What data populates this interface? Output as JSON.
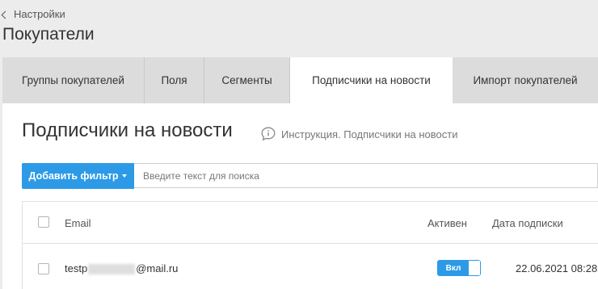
{
  "header": {
    "back_label": "Настройки",
    "title": "Покупатели"
  },
  "tabs": [
    {
      "label": "Группы покупателей",
      "active": false
    },
    {
      "label": "Поля",
      "active": false
    },
    {
      "label": "Сегменты",
      "active": false
    },
    {
      "label": "Подписчики на новости",
      "active": true
    },
    {
      "label": "Импорт покупателей",
      "active": false
    }
  ],
  "main": {
    "title": "Подписчики на новости",
    "help_link": "Инструкция. Подписчики на новости",
    "add_filter_label": "Добавить фильтр",
    "search_placeholder": "Введите текст для поиска"
  },
  "table": {
    "columns": {
      "email": "Email",
      "active": "Активен",
      "date": "Дата подписки"
    },
    "rows": [
      {
        "email_prefix": "testp",
        "email_suffix": "@mail.ru",
        "active_label": "Вкл",
        "active": true,
        "date": "22.06.2021 08:28"
      }
    ]
  },
  "colors": {
    "accent": "#2c9ae6",
    "page_background": "#ececec",
    "tab_background": "#dcdcdc"
  }
}
